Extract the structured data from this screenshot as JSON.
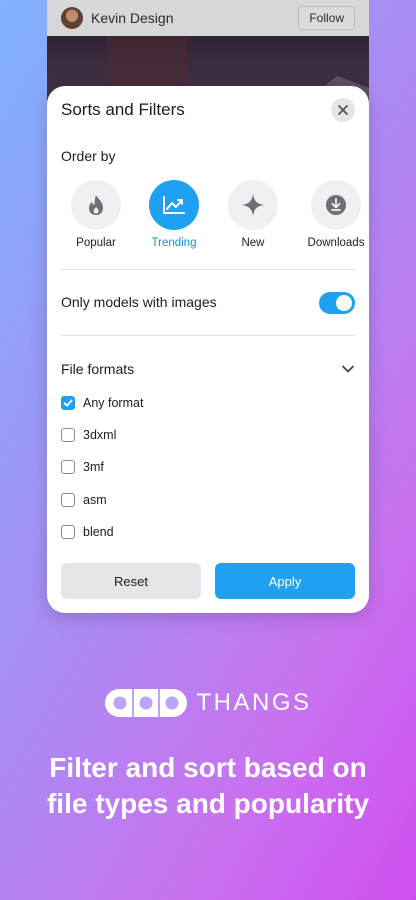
{
  "background_card": {
    "user_name": "Kevin Design",
    "follow_label": "Follow"
  },
  "sheet": {
    "title": "Sorts and Filters",
    "order_by_label": "Order by",
    "order_options": [
      {
        "label": "Popular",
        "icon": "fire-icon",
        "active": false
      },
      {
        "label": "Trending",
        "icon": "trending-icon",
        "active": true
      },
      {
        "label": "New",
        "icon": "sparkle-icon",
        "active": false
      },
      {
        "label": "Downloads",
        "icon": "download-icon",
        "active": false
      }
    ],
    "toggle_label": "Only models with images",
    "toggle_on": true,
    "file_formats_label": "File formats",
    "formats": [
      {
        "label": "Any format",
        "checked": true
      },
      {
        "label": "3dxml",
        "checked": false
      },
      {
        "label": "3mf",
        "checked": false
      },
      {
        "label": "asm",
        "checked": false
      },
      {
        "label": "blend",
        "checked": false
      }
    ],
    "reset_label": "Reset",
    "apply_label": "Apply"
  },
  "brand": {
    "wordmark": "THANGS"
  },
  "tagline": {
    "line1": "Filter and sort based on",
    "line2": "file types and popularity"
  },
  "colors": {
    "accent": "#1fa1f1",
    "gradient_start": "#7fb2ff",
    "gradient_end": "#d04ef0"
  }
}
